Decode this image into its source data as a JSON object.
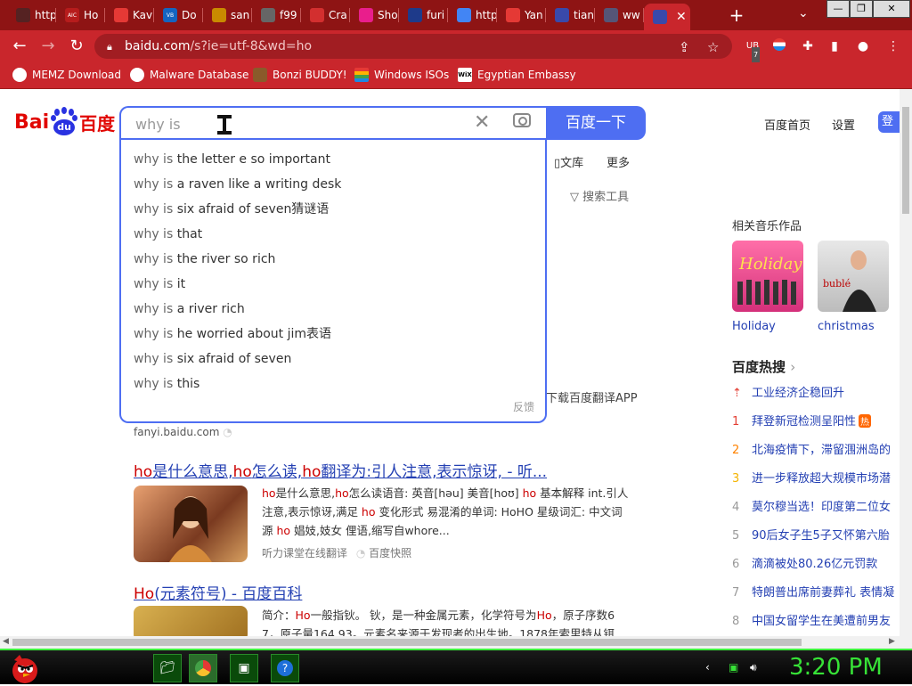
{
  "tabs": [
    {
      "label": "http",
      "fav_color": "#552222"
    },
    {
      "label": "Ho",
      "fav_color": "#b71c1c",
      "fav_text": "AIC"
    },
    {
      "label": "Kav",
      "fav_color": "#e53935"
    },
    {
      "label": "Do",
      "fav_color": "#1565c0",
      "fav_text": "VB"
    },
    {
      "label": "san",
      "fav_color": "#c98a00"
    },
    {
      "label": "f99",
      "fav_color": "#666666"
    },
    {
      "label": "Cra",
      "fav_color": "#d32f2f"
    },
    {
      "label": "Sho",
      "fav_color": "#e91e8c"
    },
    {
      "label": "furi",
      "fav_color": "#1e3a8a"
    },
    {
      "label": "http",
      "fav_color": "#4285f4"
    },
    {
      "label": "Yan",
      "fav_color": "#e53935"
    },
    {
      "label": "tian",
      "fav_color": "#3949ab"
    },
    {
      "label": "ww",
      "fav_color": "#555577"
    },
    {
      "label": "",
      "fav_color": "#3949ab",
      "active": true
    }
  ],
  "browser": {
    "url_host": "baidu.com",
    "url_path": "/s?ie=utf-8&wd=ho",
    "ext_badge": "7"
  },
  "bookmarks": [
    {
      "label": "MEMZ Download",
      "icon": "globe-icon",
      "color": "#ffffff"
    },
    {
      "label": "Malware Database",
      "icon": "globe-icon",
      "color": "#ffffff"
    },
    {
      "label": "Bonzi BUDDY!",
      "icon": "bonzi-icon",
      "color": "#6a3fb5"
    },
    {
      "label": "Windows ISOs",
      "icon": "windows-icon",
      "color": "#ffb300"
    },
    {
      "label": "Egyptian Embassy",
      "icon": "wix-icon",
      "color": "#ffffff"
    }
  ],
  "baidu": {
    "logo_bai": "Bai",
    "logo_du": "du",
    "logo_zh": "百度",
    "search_value": "why is",
    "search_button": "百度一下",
    "home": "百度首页",
    "settings": "设置",
    "login": "登",
    "tab_wenku": "文库",
    "tab_more": "更多",
    "search_tools": "搜索工具",
    "feedback": "反馈",
    "suggestions": [
      {
        "prefix": "why is",
        "rest": " the letter e so important"
      },
      {
        "prefix": "why is",
        "rest": " a raven like a writing desk"
      },
      {
        "prefix": "why is",
        "rest": " six afraid of seven猜谜语"
      },
      {
        "prefix": "why is",
        "rest": " that"
      },
      {
        "prefix": "why is",
        "rest": " the river so rich"
      },
      {
        "prefix": "why is",
        "rest": " it"
      },
      {
        "prefix": "why is",
        "rest": " a river rich"
      },
      {
        "prefix": "why is",
        "rest": " he worried about jim表语"
      },
      {
        "prefix": "why is",
        "rest": " six afraid of seven"
      },
      {
        "prefix": "why is",
        "rest": " this"
      }
    ]
  },
  "results": {
    "fanyi_app": "下载百度翻译APP",
    "fanyi_url": "fanyi.baidu.com",
    "r1_title": [
      "ho",
      "是什么意思,",
      "ho",
      "怎么读,",
      "ho",
      "翻译为:引人注意,表示惊讶, - 听..."
    ],
    "r1_snip1": [
      "ho",
      "是什么意思,",
      "ho",
      "怎么读语音: 英音[həu] 美音[hoʊ] ",
      "ho",
      " 基本解释 int.引人"
    ],
    "r1_snip2": [
      "注意,表示惊讶,满足 ",
      "ho",
      " 变化形式 易混淆的单词: HoHO 星级词汇: 中文词"
    ],
    "r1_snip3": [
      "源 ",
      "ho",
      " 娼妓,妓女 俚语,缩写自whore..."
    ],
    "r1_src1": "听力课堂在线翻译",
    "r1_src2": "百度快照",
    "r2_title": [
      "Ho",
      "(元素符号) - 百度百科"
    ],
    "r2_snip1": [
      "简介：",
      "Ho",
      "一般指钬。 钬，是一种金属元素，化学符号为",
      "Ho",
      "，原子序数6"
    ],
    "r2_snip2": "7，原子量164.93。元素名来源于发现者的出生地。1878年索里特从铒"
  },
  "sidebar": {
    "music_head": "相关音乐作品",
    "albums": [
      {
        "label": "Holiday"
      },
      {
        "label": "christmas"
      }
    ],
    "hot_head": "百度热搜",
    "hot": [
      {
        "rank": "⇡",
        "title": "工业经济企稳回升",
        "color": "#e33e33"
      },
      {
        "rank": "1",
        "title": "拜登新冠检测呈阳性",
        "color": "#e33e33",
        "badge": "热"
      },
      {
        "rank": "2",
        "title": "北海疫情下，滞留涠洲岛的",
        "color": "#ff8200"
      },
      {
        "rank": "3",
        "title": "进一步释放超大规模市场潜",
        "color": "#f4b400"
      },
      {
        "rank": "4",
        "title": "莫尔穆当选！印度第二位女",
        "color": "#999999"
      },
      {
        "rank": "5",
        "title": "90后女子生5子又怀第六胎",
        "color": "#999999"
      },
      {
        "rank": "6",
        "title": "滴滴被处80.26亿元罚款",
        "color": "#999999"
      },
      {
        "rank": "7",
        "title": "特朗普出席前妻葬礼 表情凝",
        "color": "#999999"
      },
      {
        "rank": "8",
        "title": "中国女留学生在美遭前男友",
        "color": "#999999"
      }
    ]
  },
  "taskbar": {
    "clock": "3:20 PM"
  }
}
